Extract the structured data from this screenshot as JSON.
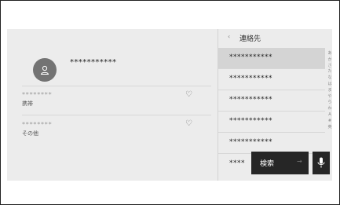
{
  "contact": {
    "name": "***********"
  },
  "numbers": [
    {
      "number": "********",
      "type": "携帯"
    },
    {
      "number": "********",
      "type": "その他"
    }
  ],
  "list": {
    "back_icon": "‹",
    "title": "連絡先",
    "items": [
      "***********",
      "***********",
      "***********",
      "***********",
      "***********",
      "****"
    ]
  },
  "kana_index": [
    "あ",
    "か",
    "さ",
    "た",
    "な",
    "は",
    "ま",
    "や",
    "ら",
    "わ",
    "A",
    "#",
    "英"
  ],
  "search": {
    "label": "検索",
    "arrow": "→"
  }
}
